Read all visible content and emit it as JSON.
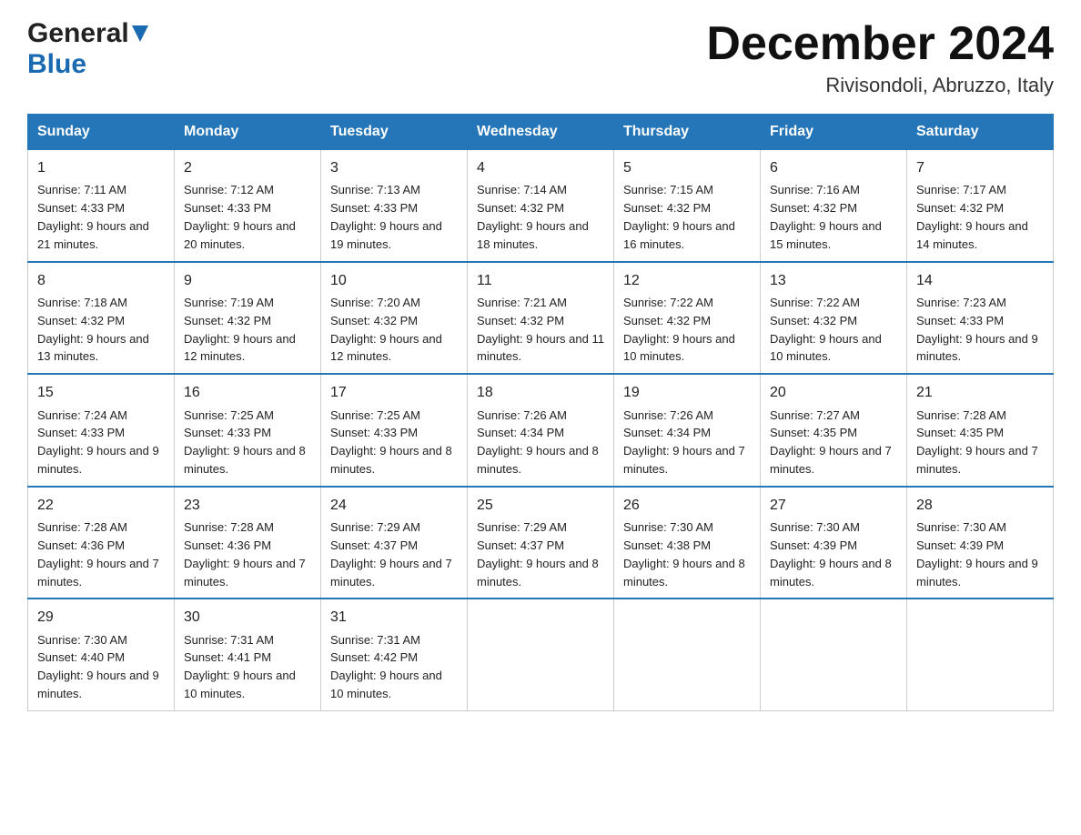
{
  "header": {
    "logo_general": "General",
    "logo_blue": "Blue",
    "month_title": "December 2024",
    "location": "Rivisondoli, Abruzzo, Italy"
  },
  "days_of_week": [
    "Sunday",
    "Monday",
    "Tuesday",
    "Wednesday",
    "Thursday",
    "Friday",
    "Saturday"
  ],
  "weeks": [
    [
      {
        "day": "1",
        "sunrise": "7:11 AM",
        "sunset": "4:33 PM",
        "daylight": "9 hours and 21 minutes."
      },
      {
        "day": "2",
        "sunrise": "7:12 AM",
        "sunset": "4:33 PM",
        "daylight": "9 hours and 20 minutes."
      },
      {
        "day": "3",
        "sunrise": "7:13 AM",
        "sunset": "4:33 PM",
        "daylight": "9 hours and 19 minutes."
      },
      {
        "day": "4",
        "sunrise": "7:14 AM",
        "sunset": "4:32 PM",
        "daylight": "9 hours and 18 minutes."
      },
      {
        "day": "5",
        "sunrise": "7:15 AM",
        "sunset": "4:32 PM",
        "daylight": "9 hours and 16 minutes."
      },
      {
        "day": "6",
        "sunrise": "7:16 AM",
        "sunset": "4:32 PM",
        "daylight": "9 hours and 15 minutes."
      },
      {
        "day": "7",
        "sunrise": "7:17 AM",
        "sunset": "4:32 PM",
        "daylight": "9 hours and 14 minutes."
      }
    ],
    [
      {
        "day": "8",
        "sunrise": "7:18 AM",
        "sunset": "4:32 PM",
        "daylight": "9 hours and 13 minutes."
      },
      {
        "day": "9",
        "sunrise": "7:19 AM",
        "sunset": "4:32 PM",
        "daylight": "9 hours and 12 minutes."
      },
      {
        "day": "10",
        "sunrise": "7:20 AM",
        "sunset": "4:32 PM",
        "daylight": "9 hours and 12 minutes."
      },
      {
        "day": "11",
        "sunrise": "7:21 AM",
        "sunset": "4:32 PM",
        "daylight": "9 hours and 11 minutes."
      },
      {
        "day": "12",
        "sunrise": "7:22 AM",
        "sunset": "4:32 PM",
        "daylight": "9 hours and 10 minutes."
      },
      {
        "day": "13",
        "sunrise": "7:22 AM",
        "sunset": "4:32 PM",
        "daylight": "9 hours and 10 minutes."
      },
      {
        "day": "14",
        "sunrise": "7:23 AM",
        "sunset": "4:33 PM",
        "daylight": "9 hours and 9 minutes."
      }
    ],
    [
      {
        "day": "15",
        "sunrise": "7:24 AM",
        "sunset": "4:33 PM",
        "daylight": "9 hours and 9 minutes."
      },
      {
        "day": "16",
        "sunrise": "7:25 AM",
        "sunset": "4:33 PM",
        "daylight": "9 hours and 8 minutes."
      },
      {
        "day": "17",
        "sunrise": "7:25 AM",
        "sunset": "4:33 PM",
        "daylight": "9 hours and 8 minutes."
      },
      {
        "day": "18",
        "sunrise": "7:26 AM",
        "sunset": "4:34 PM",
        "daylight": "9 hours and 8 minutes."
      },
      {
        "day": "19",
        "sunrise": "7:26 AM",
        "sunset": "4:34 PM",
        "daylight": "9 hours and 7 minutes."
      },
      {
        "day": "20",
        "sunrise": "7:27 AM",
        "sunset": "4:35 PM",
        "daylight": "9 hours and 7 minutes."
      },
      {
        "day": "21",
        "sunrise": "7:28 AM",
        "sunset": "4:35 PM",
        "daylight": "9 hours and 7 minutes."
      }
    ],
    [
      {
        "day": "22",
        "sunrise": "7:28 AM",
        "sunset": "4:36 PM",
        "daylight": "9 hours and 7 minutes."
      },
      {
        "day": "23",
        "sunrise": "7:28 AM",
        "sunset": "4:36 PM",
        "daylight": "9 hours and 7 minutes."
      },
      {
        "day": "24",
        "sunrise": "7:29 AM",
        "sunset": "4:37 PM",
        "daylight": "9 hours and 7 minutes."
      },
      {
        "day": "25",
        "sunrise": "7:29 AM",
        "sunset": "4:37 PM",
        "daylight": "9 hours and 8 minutes."
      },
      {
        "day": "26",
        "sunrise": "7:30 AM",
        "sunset": "4:38 PM",
        "daylight": "9 hours and 8 minutes."
      },
      {
        "day": "27",
        "sunrise": "7:30 AM",
        "sunset": "4:39 PM",
        "daylight": "9 hours and 8 minutes."
      },
      {
        "day": "28",
        "sunrise": "7:30 AM",
        "sunset": "4:39 PM",
        "daylight": "9 hours and 9 minutes."
      }
    ],
    [
      {
        "day": "29",
        "sunrise": "7:30 AM",
        "sunset": "4:40 PM",
        "daylight": "9 hours and 9 minutes."
      },
      {
        "day": "30",
        "sunrise": "7:31 AM",
        "sunset": "4:41 PM",
        "daylight": "9 hours and 10 minutes."
      },
      {
        "day": "31",
        "sunrise": "7:31 AM",
        "sunset": "4:42 PM",
        "daylight": "9 hours and 10 minutes."
      },
      {
        "day": "",
        "sunrise": "",
        "sunset": "",
        "daylight": ""
      },
      {
        "day": "",
        "sunrise": "",
        "sunset": "",
        "daylight": ""
      },
      {
        "day": "",
        "sunrise": "",
        "sunset": "",
        "daylight": ""
      },
      {
        "day": "",
        "sunrise": "",
        "sunset": "",
        "daylight": ""
      }
    ]
  ],
  "labels": {
    "sunrise_prefix": "Sunrise: ",
    "sunset_prefix": "Sunset: ",
    "daylight_prefix": "Daylight: "
  }
}
